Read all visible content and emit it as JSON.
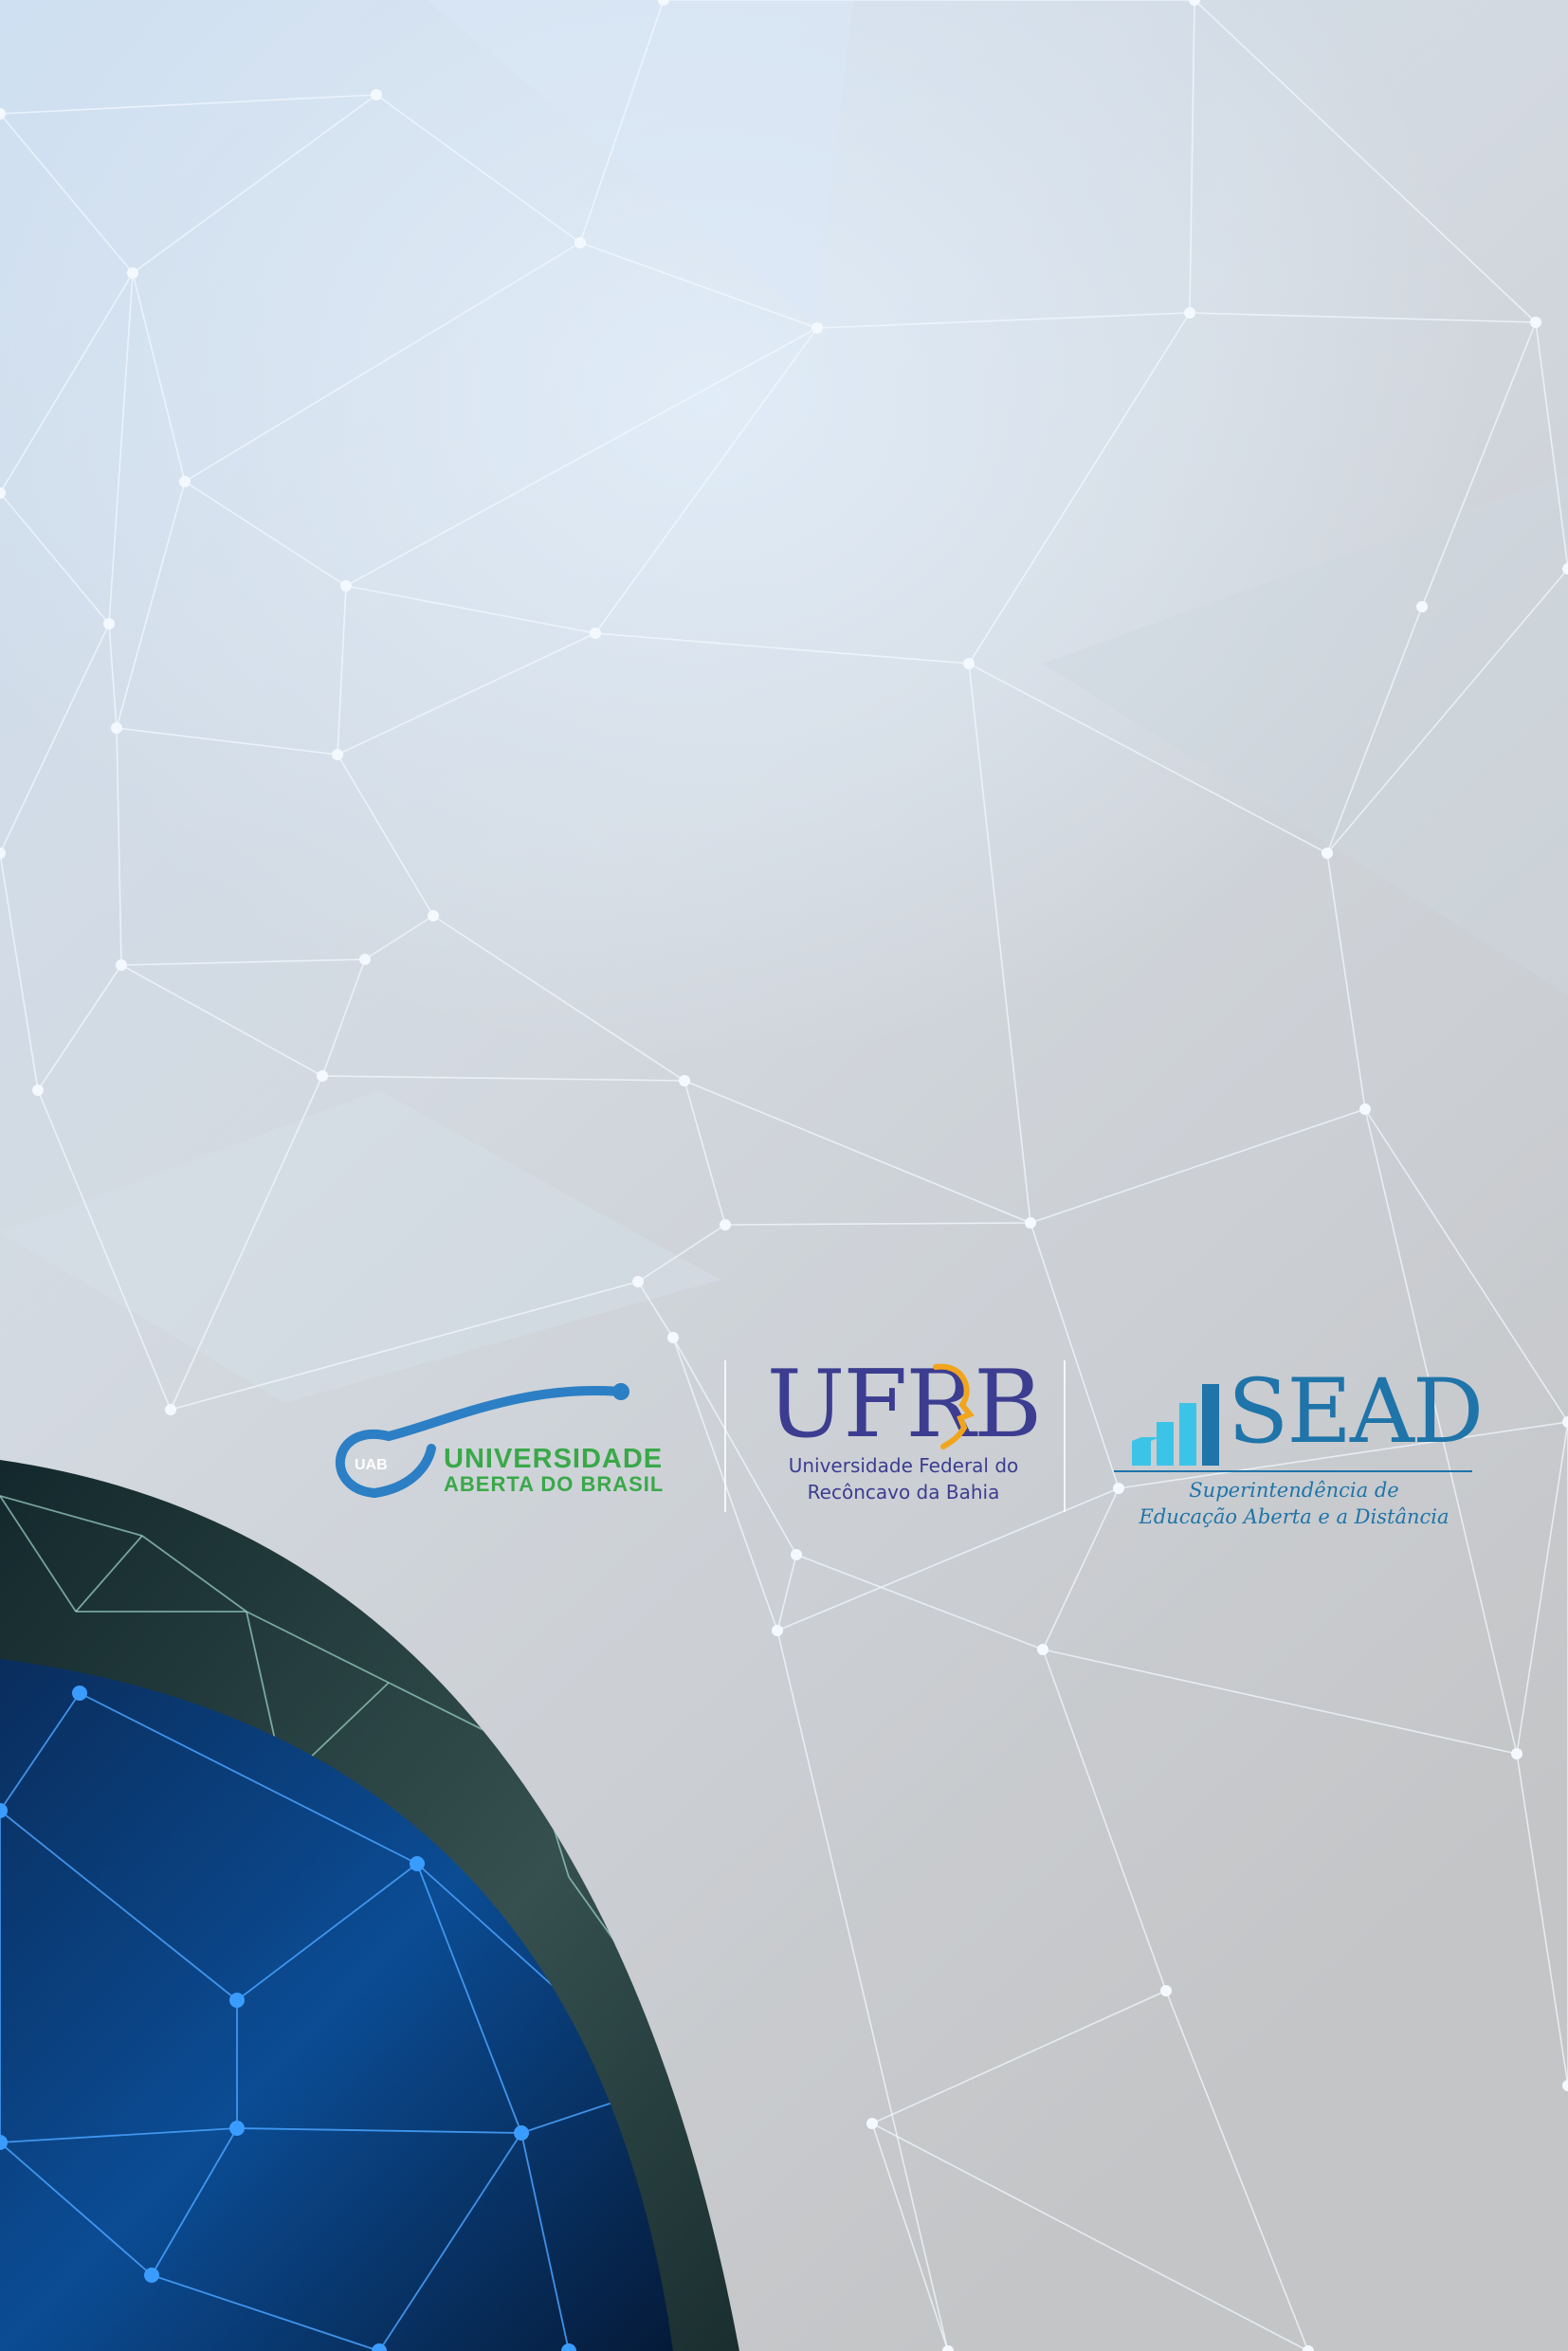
{
  "background": {
    "base_color": "#c9cacc",
    "network_color": "#eaf3ff"
  },
  "logos": {
    "uab": {
      "badge": "UAB",
      "line1": "UNIVERSIDADE",
      "line2": "ABERTA DO BRASIL",
      "colors": {
        "arc": "#2c7fc4",
        "text": "#3aa849"
      }
    },
    "ufrb": {
      "mark": "UFRB",
      "line1": "Universidade Federal do",
      "line2": "Recôncavo da Bahia",
      "colors": {
        "text": "#3c3d90",
        "accent": "#f2a51c"
      }
    },
    "sead": {
      "word": "SEAD",
      "line1": "Superintendência de",
      "line2": "Educação Aberta e a Distância",
      "colors": {
        "text": "#1f74a9",
        "bars": "#3cc4e8"
      }
    }
  },
  "globe": {
    "outer_color": "#2d4a4e",
    "inner_color": "#0b3a78"
  }
}
